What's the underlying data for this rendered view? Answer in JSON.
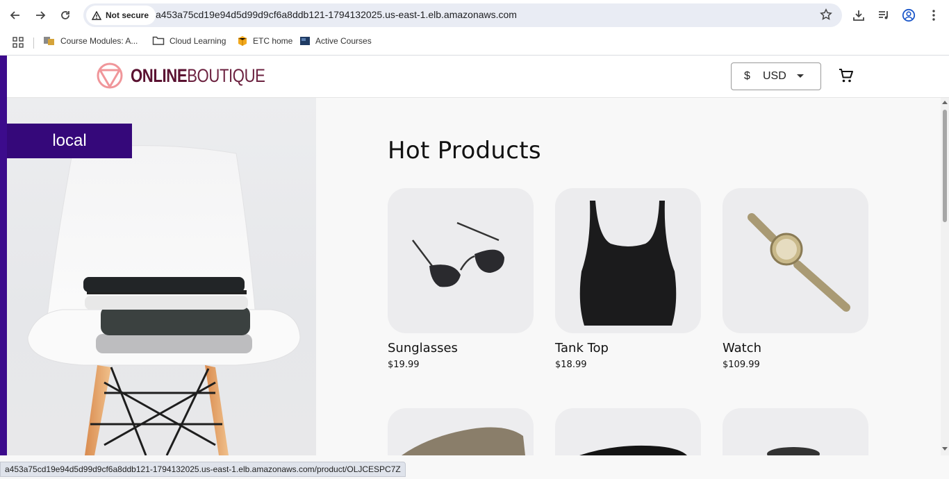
{
  "browser": {
    "security_label": "Not secure",
    "url": "a453a75cd19e94d5d99d9cf6a8ddb121-1794132025.us-east-1.elb.amazonaws.com",
    "status_url": "a453a75cd19e94d5d99d9cf6a8ddb121-1794132025.us-east-1.elb.amazonaws.com/product/OLJCESPC7Z",
    "bookmarks": [
      {
        "label": "Course Modules: A...",
        "icon": "course-favicon"
      },
      {
        "label": "Cloud Learning",
        "icon": "folder-icon"
      },
      {
        "label": "ETC home",
        "icon": "aws-box-icon"
      },
      {
        "label": "Active Courses",
        "icon": "book-icon"
      }
    ]
  },
  "site": {
    "logo_bold": "ONLINE",
    "logo_light": "BOUTIQUE",
    "currency_symbol": "$",
    "currency_code": "USD",
    "banner_label": "local",
    "heading": "Hot Products",
    "accent_color": "#35087a",
    "logo_color": "#5a1231"
  },
  "products": [
    {
      "name": "Sunglasses",
      "price": "$19.99"
    },
    {
      "name": "Tank Top",
      "price": "$18.99"
    },
    {
      "name": "Watch",
      "price": "$109.99"
    }
  ]
}
